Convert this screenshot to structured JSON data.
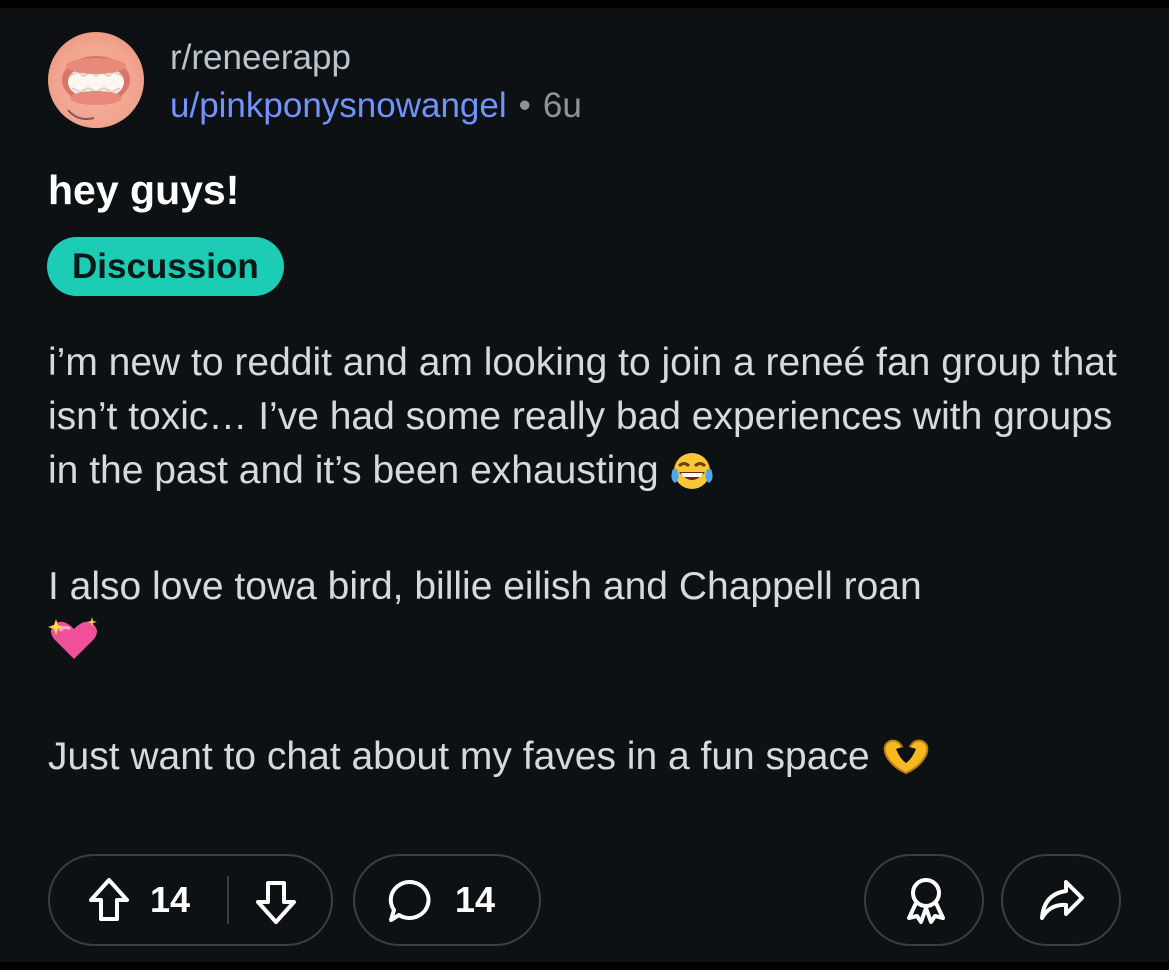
{
  "post": {
    "subreddit": "r/reneerapp",
    "author": "u/pinkponysnowangel",
    "separator": "•",
    "age": "6u",
    "title": "hey guys!",
    "flair": "Discussion",
    "flair_color": "#1cccb5",
    "body": {
      "p1": "i’m new to reddit and am looking to join a reneé fan group that isn’t toxic… I’ve had some really bad experiences with groups in the past and it’s been exhausting",
      "p1_emoji": "face-with-tears-of-joy",
      "p2": "I also love towa bird, billie eilish and Chappell roan",
      "p2_emoji": "sparkling-heart",
      "p3": "Just want to chat about my faves in a fun space",
      "p3_emoji": "heart-hands"
    }
  },
  "actions": {
    "upvotes": "14",
    "comments": "14",
    "icons": [
      "upvote-icon",
      "downvote-icon",
      "comment-icon",
      "award-icon",
      "share-icon"
    ]
  },
  "colors": {
    "background": "#0e1113",
    "author_link": "#7193ff",
    "text": "#d7dadc"
  }
}
